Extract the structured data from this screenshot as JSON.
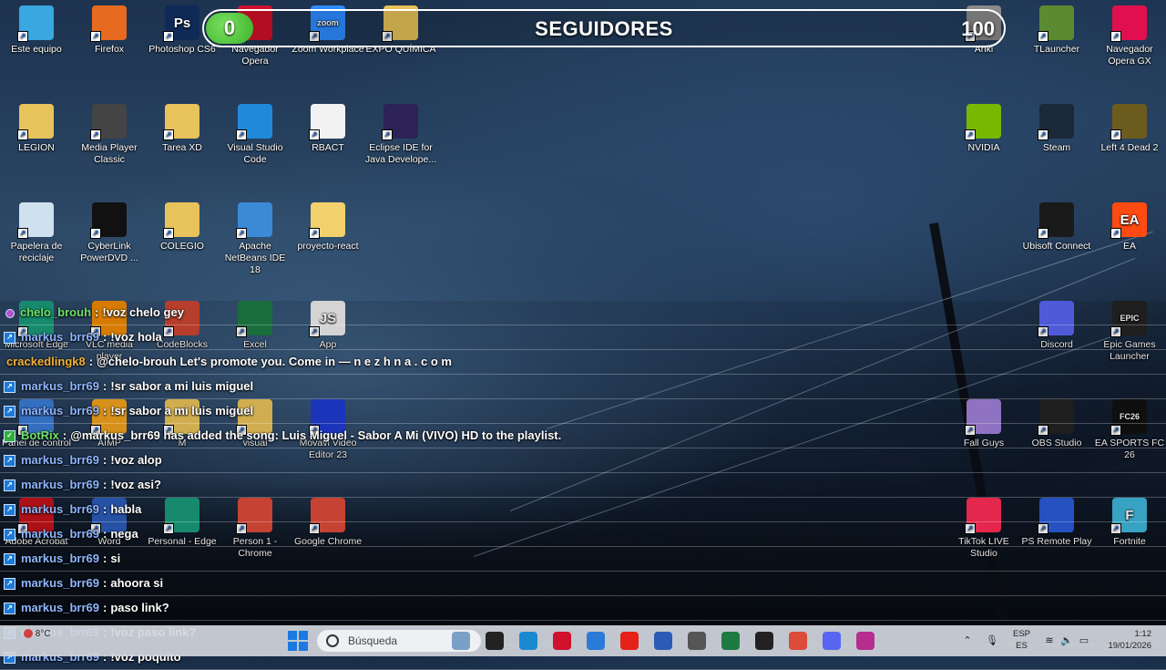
{
  "desktop_icons": [
    {
      "label": "Este equipo",
      "icon": "monitor-icon",
      "color": "#39a7e0"
    },
    {
      "label": "Firefox",
      "icon": "firefox-icon",
      "color": "#e66a1f"
    },
    {
      "label": "Photoshop CS6",
      "icon": "photoshop-icon",
      "color": "#0f2a56",
      "glyph": "Ps"
    },
    {
      "label": "Navegador Opera",
      "icon": "opera-icon",
      "color": "#d0112b"
    },
    {
      "label": "Zoom Workplace",
      "icon": "zoom-icon",
      "color": "#2d8cff",
      "glyph": "zoom"
    },
    {
      "label": "EXPO QUÍMICA",
      "icon": "folder-icon",
      "color": "#e8c25a"
    },
    {
      "label": "Anki",
      "icon": "anki-icon",
      "color": "#8a8a8a"
    },
    {
      "label": "TLauncher",
      "icon": "minecraft-icon",
      "color": "#5b8a32"
    },
    {
      "label": "Navegador Opera GX",
      "icon": "opera-gx-icon",
      "color": "#e0104e"
    },
    {
      "label": "LEGION",
      "icon": "user-folder-icon",
      "color": "#e8c25a"
    },
    {
      "label": "Media Player Classic",
      "icon": "clapperboard-icon",
      "color": "#444"
    },
    {
      "label": "Tarea XD",
      "icon": "folder-icon",
      "color": "#e8c25a"
    },
    {
      "label": "Visual Studio Code",
      "icon": "vscode-icon",
      "color": "#1f8ad8"
    },
    {
      "label": "RBACT",
      "icon": "document-icon",
      "color": "#f2f2f2"
    },
    {
      "label": "Eclipse IDE for Java Develope...",
      "icon": "eclipse-icon",
      "color": "#2c2255"
    },
    {
      "label": "NVIDIA",
      "icon": "nvidia-icon",
      "color": "#76b900"
    },
    {
      "label": "Steam",
      "icon": "steam-icon",
      "color": "#1b2838"
    },
    {
      "label": "Left 4 Dead 2",
      "icon": "l4d2-icon",
      "color": "#6b5b1c"
    },
    {
      "label": "Papelera de reciclaje",
      "icon": "recycle-bin-icon",
      "color": "#cfe0ee"
    },
    {
      "label": "CyberLink PowerDVD ...",
      "icon": "powerdvd-icon",
      "color": "#111"
    },
    {
      "label": "COLEGIO",
      "icon": "folder-icon",
      "color": "#e8c25a"
    },
    {
      "label": "Apache NetBeans IDE 18",
      "icon": "netbeans-icon",
      "color": "#3b8ad6"
    },
    {
      "label": "proyecto-react",
      "icon": "folder-icon",
      "color": "#f2d06b"
    },
    {
      "label": "Ubisoft Connect",
      "icon": "ubisoft-icon",
      "color": "#1a1a1a"
    },
    {
      "label": "EA",
      "icon": "ea-icon",
      "color": "#ff4a12",
      "glyph": "EA"
    },
    {
      "label": "Microsoft Edge",
      "icon": "edge-icon",
      "color": "#1a9a7a"
    },
    {
      "label": "VLC media player",
      "icon": "vlc-icon",
      "color": "#f08a00"
    },
    {
      "label": "CodeBlocks",
      "icon": "codeblocks-icon",
      "color": "#c43"
    },
    {
      "label": "Excel",
      "icon": "excel-icon",
      "color": "#1e7a43"
    },
    {
      "label": "App",
      "icon": "js-file-icon",
      "color": "#ececec",
      "glyph": "JS"
    },
    {
      "label": "Discord",
      "icon": "discord-icon",
      "color": "#5865f2"
    },
    {
      "label": "Epic Games Launcher",
      "icon": "epic-games-icon",
      "color": "#222",
      "glyph": "EPIC"
    },
    {
      "label": "Panel de control",
      "icon": "control-panel-icon",
      "color": "#3a7bd5"
    },
    {
      "label": "AIMP",
      "icon": "aimp-icon",
      "color": "#f0a21f"
    },
    {
      "label": "M",
      "icon": "folder-icon",
      "color": "#e8c25a"
    },
    {
      "label": "visual",
      "icon": "folder-icon",
      "color": "#e8c25a"
    },
    {
      "label": "Movavi Video Editor 23",
      "icon": "movavi-icon",
      "color": "#1f3bd0"
    },
    {
      "label": "Fall Guys",
      "icon": "fall-guys-icon",
      "color": "#a07fd8"
    },
    {
      "label": "OBS Studio",
      "icon": "obs-icon",
      "color": "#222"
    },
    {
      "label": "EA SPORTS FC 26",
      "icon": "fc26-icon",
      "color": "#111",
      "glyph": "FC26"
    },
    {
      "label": "Adobe Acrobat",
      "icon": "acrobat-icon",
      "color": "#c1141a"
    },
    {
      "label": "Word",
      "icon": "word-icon",
      "color": "#2b5bb8"
    },
    {
      "label": "Personal - Edge",
      "icon": "edge-icon",
      "color": "#1a9a7a"
    },
    {
      "label": "Person 1 - Chrome",
      "icon": "chrome-icon",
      "color": "#dd4b39"
    },
    {
      "label": "Google Chrome",
      "icon": "chrome-icon",
      "color": "#dd4b39"
    },
    {
      "label": "TikTok LIVE Studio",
      "icon": "tiktok-icon",
      "color": "#fe2c55"
    },
    {
      "label": "PS Remote Play",
      "icon": "ps-remote-play-icon",
      "color": "#2a5bd7"
    },
    {
      "label": "Fortnite",
      "icon": "fortnite-icon",
      "color": "#3fb5d8",
      "glyph": "F"
    }
  ],
  "followers_widget": {
    "title": "SEGUIDORES",
    "current": "0",
    "goal": "100",
    "progress_fraction": 0.0,
    "fill_color": "#3cb22a"
  },
  "chat": [
    {
      "user": "chelo_brouh",
      "message": "!voz chelo gey",
      "badge": "mic",
      "color": "green"
    },
    {
      "user": "markus_brr69",
      "message": "!voz hola",
      "badge": "sub",
      "color": "blue"
    },
    {
      "user": "crackedlingk8",
      "message": "@chelo-brouh Let's promote you. Come in — n e z h n a . c o m",
      "badge": "none",
      "color": "gold"
    },
    {
      "user": "markus_brr69",
      "message": "!sr sabor a mi luis miguel",
      "badge": "sub",
      "color": "blue"
    },
    {
      "user": "markus_brr69",
      "message": "!sr sabor a mi luis miguel",
      "badge": "sub",
      "color": "blue"
    },
    {
      "user": "BotRix",
      "message": "@markus_brr69 has added the song: Luis Miguel - Sabor A Mi (VIVO) HD to the playlist.",
      "badge": "bot",
      "color": "green"
    },
    {
      "user": "markus_brr69",
      "message": "!voz alop",
      "badge": "sub",
      "color": "blue"
    },
    {
      "user": "markus_brr69",
      "message": "!voz asi?",
      "badge": "sub",
      "color": "blue"
    },
    {
      "user": "markus_brr69",
      "message": "habla",
      "badge": "sub",
      "color": "blue"
    },
    {
      "user": "markus_brr69",
      "message": "nega",
      "badge": "sub",
      "color": "blue"
    },
    {
      "user": "markus_brr69",
      "message": "si",
      "badge": "sub",
      "color": "blue"
    },
    {
      "user": "markus_brr69",
      "message": "ahoora si",
      "badge": "sub",
      "color": "blue"
    },
    {
      "user": "markus_brr69",
      "message": "paso link?",
      "badge": "sub",
      "color": "blue"
    },
    {
      "user": "markus_brr69",
      "message": "!voz paso link?",
      "badge": "sub",
      "color": "blue"
    },
    {
      "user": "markus_brr69",
      "message": "!voz poquito",
      "badge": "sub",
      "color": "blue"
    }
  ],
  "chat_separator": ":",
  "taskbar": {
    "weather": "8°C",
    "search_placeholder": "Búsqueda",
    "apps": [
      {
        "name": "widgets",
        "icon": "widgets-icon",
        "color": "#7aa0c8"
      },
      {
        "name": "explorer",
        "icon": "file-explorer-icon",
        "color": "#222"
      },
      {
        "name": "edge",
        "icon": "edge-icon",
        "color": "#1a8ad0"
      },
      {
        "name": "opera",
        "icon": "opera-icon",
        "color": "#d0112b"
      },
      {
        "name": "mail",
        "icon": "mail-icon",
        "color": "#2a7ad8"
      },
      {
        "name": "youtube",
        "icon": "youtube-icon",
        "color": "#e62117"
      },
      {
        "name": "word",
        "icon": "word-icon",
        "color": "#2b5bb8"
      },
      {
        "name": "asus",
        "icon": "asus-icon",
        "color": "#555"
      },
      {
        "name": "excel",
        "icon": "excel-icon",
        "color": "#1e7a43"
      },
      {
        "name": "obs",
        "icon": "obs-icon",
        "color": "#222"
      },
      {
        "name": "chrome",
        "icon": "chrome-icon",
        "color": "#dd4b39"
      },
      {
        "name": "discord",
        "icon": "discord-icon",
        "color": "#5865f2"
      },
      {
        "name": "visual-studio",
        "icon": "visual-studio-icon",
        "color": "#b52e8f"
      }
    ],
    "language_line1": "ESP",
    "language_line2": "ES",
    "time": "1:12",
    "date": "19/01/2026"
  }
}
